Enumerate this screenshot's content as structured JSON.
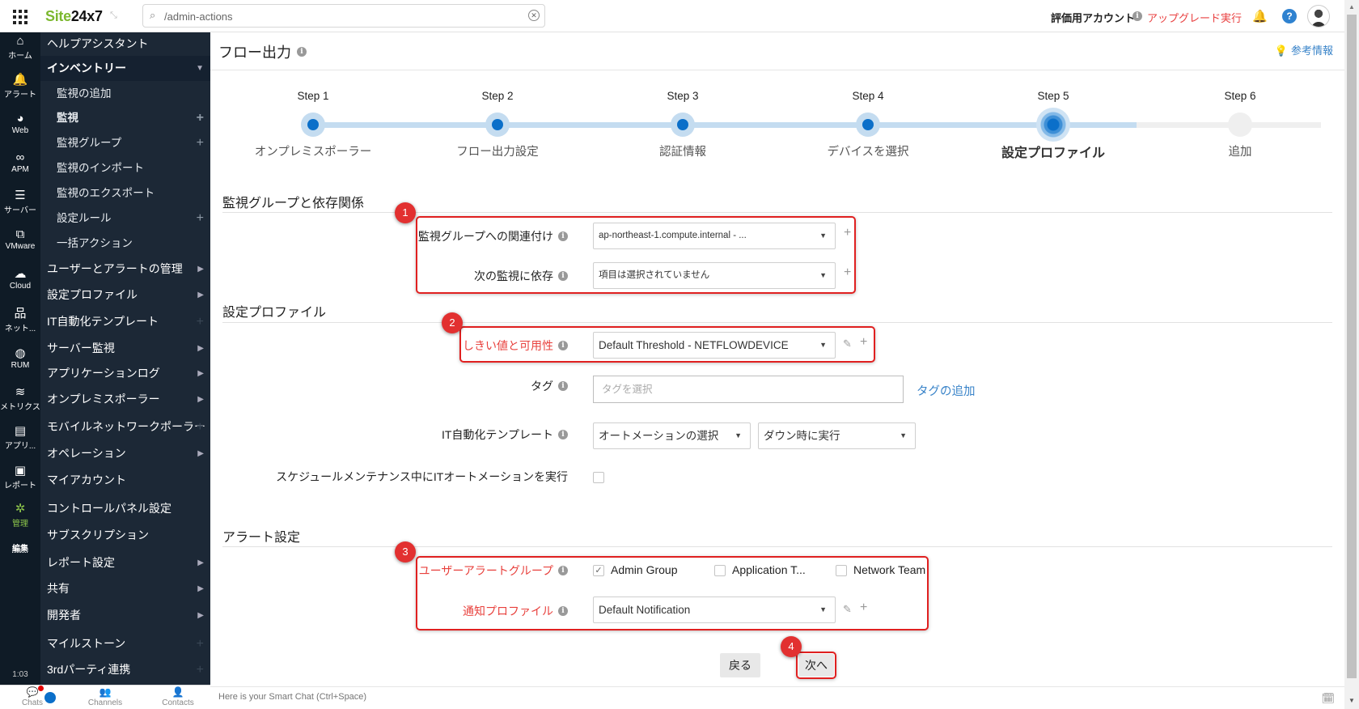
{
  "topbar": {
    "brand_green": "Site",
    "brand_dark": "24x7",
    "search_value": "/admin-actions",
    "account": "評価用アカウント",
    "upgrade": "アップグレード実行"
  },
  "rail": [
    {
      "label": "ホーム",
      "icon": "home-icon",
      "glyph": "⌂"
    },
    {
      "label": "アラート",
      "icon": "bell-icon",
      "glyph": "🔔"
    },
    {
      "label": "Web",
      "icon": "globe-icon",
      "glyph": "◕"
    },
    {
      "label": "APM",
      "icon": "binoculars-icon",
      "glyph": "∞"
    },
    {
      "label": "サーバー",
      "icon": "server-icon",
      "glyph": "☰"
    },
    {
      "label": "VMware",
      "icon": "vmware-icon",
      "glyph": "⧉"
    },
    {
      "label": "Cloud",
      "icon": "cloud-icon",
      "glyph": "☁"
    },
    {
      "label": "ネット...",
      "icon": "network-icon",
      "glyph": "品"
    },
    {
      "label": "RUM",
      "icon": "rum-icon",
      "glyph": "◍"
    },
    {
      "label": "メトリクス",
      "icon": "layers-icon",
      "glyph": "≋"
    },
    {
      "label": "アプリ...",
      "icon": "app-icon",
      "glyph": "▤"
    },
    {
      "label": "レポート",
      "icon": "report-icon",
      "glyph": "▣"
    },
    {
      "label": "管理",
      "icon": "gear-icon",
      "glyph": "✲"
    },
    {
      "label": "編集",
      "icon": "",
      "glyph": ""
    }
  ],
  "rail_time": "1:03",
  "menu": {
    "items": [
      {
        "label": "ヘルプアシスタント",
        "type": "top"
      },
      {
        "label": "インベントリー",
        "type": "open"
      },
      {
        "label": "監視の追加",
        "type": "sub"
      },
      {
        "label": "監視",
        "type": "sub-bold",
        "plus": true
      },
      {
        "label": "監視グループ",
        "type": "sub",
        "plus": true
      },
      {
        "label": "監視のインポート",
        "type": "sub"
      },
      {
        "label": "監視のエクスポート",
        "type": "sub"
      },
      {
        "label": "設定ルール",
        "type": "sub",
        "plus": true
      },
      {
        "label": "一括アクション",
        "type": "sub"
      },
      {
        "label": "ユーザーとアラートの管理",
        "type": "top",
        "arrow": true
      },
      {
        "label": "設定プロファイル",
        "type": "top",
        "arrow": true
      },
      {
        "label": "IT自動化テンプレート",
        "type": "top",
        "dimplus": true
      },
      {
        "label": "サーバー監視",
        "type": "top",
        "arrow": true
      },
      {
        "label": "アプリケーションログ",
        "type": "top",
        "arrow": true
      },
      {
        "label": "オンプレミスポーラー",
        "type": "top",
        "arrow": true
      },
      {
        "label": "モバイルネットワークポーラー",
        "type": "top",
        "dimplus": true
      },
      {
        "label": "オペレーション",
        "type": "top",
        "arrow": true
      },
      {
        "label": "マイアカウント",
        "type": "top"
      },
      {
        "label": "コントロールパネル設定",
        "type": "top"
      },
      {
        "label": "サブスクリプション",
        "type": "top"
      },
      {
        "label": "レポート設定",
        "type": "top",
        "arrow": true
      },
      {
        "label": "共有",
        "type": "top",
        "arrow": true
      },
      {
        "label": "開発者",
        "type": "top",
        "arrow": true
      },
      {
        "label": "マイルストーン",
        "type": "top",
        "dimplus": true
      },
      {
        "label": "3rdパーティ連携",
        "type": "top",
        "dimplus": true
      }
    ]
  },
  "chatbar": {
    "tabs": [
      "Chats",
      "Channels",
      "Contacts"
    ],
    "smartchat_placeholder": "Here is your Smart Chat (Ctrl+Space)"
  },
  "page": {
    "title": "フロー出力",
    "reference_link": "参考情報"
  },
  "stepper": {
    "current_step": 5,
    "steps": [
      {
        "label": "Step 1",
        "name": "オンプレミスポーラー"
      },
      {
        "label": "Step 2",
        "name": "フロー出力設定"
      },
      {
        "label": "Step 3",
        "name": "認証情報"
      },
      {
        "label": "Step 4",
        "name": "デバイスを選択"
      },
      {
        "label": "Step 5",
        "name": "設定プロファイル"
      },
      {
        "label": "Step 6",
        "name": "追加"
      }
    ]
  },
  "sections": {
    "groups": {
      "title": "監視グループと依存関係",
      "monitor_group_label": "監視グループへの関連付け",
      "monitor_group_value": "ap-northeast-1.compute.internal - ...",
      "dependency_label": "次の監視に依存",
      "dependency_value": "項目は選択されていません"
    },
    "profile": {
      "title": "設定プロファイル",
      "threshold_label": "しきい値と可用性",
      "threshold_value": "Default Threshold - NETFLOWDEVICE",
      "tag_label": "タグ",
      "tag_placeholder": "タグを選択",
      "add_tag_link": "タグの追加",
      "it_auto_label": "IT自動化テンプレート",
      "automation_value": "オートメーションの選択",
      "run_on_value": "ダウン時に実行",
      "schedule_label": "スケジュールメンテナンス中にITオートメーションを実行",
      "schedule_checked": false
    },
    "alerts": {
      "title": "アラート設定",
      "user_group_label": "ユーザーアラートグループ",
      "groups": [
        {
          "label": "Admin Group",
          "checked": true
        },
        {
          "label": "Application T...",
          "checked": false
        },
        {
          "label": "Network Team",
          "checked": false
        }
      ],
      "notification_label": "通知プロファイル",
      "notification_value": "Default Notification"
    }
  },
  "annotations": [
    "1",
    "2",
    "3",
    "4"
  ],
  "buttons": {
    "back": "戻る",
    "next": "次へ"
  },
  "colors": {
    "accent_blue": "#0b6fc9",
    "annotation_red": "#e02020",
    "brand_green": "#7cb82f",
    "required_red": "#e8413d",
    "link_blue": "#3a84c9"
  }
}
